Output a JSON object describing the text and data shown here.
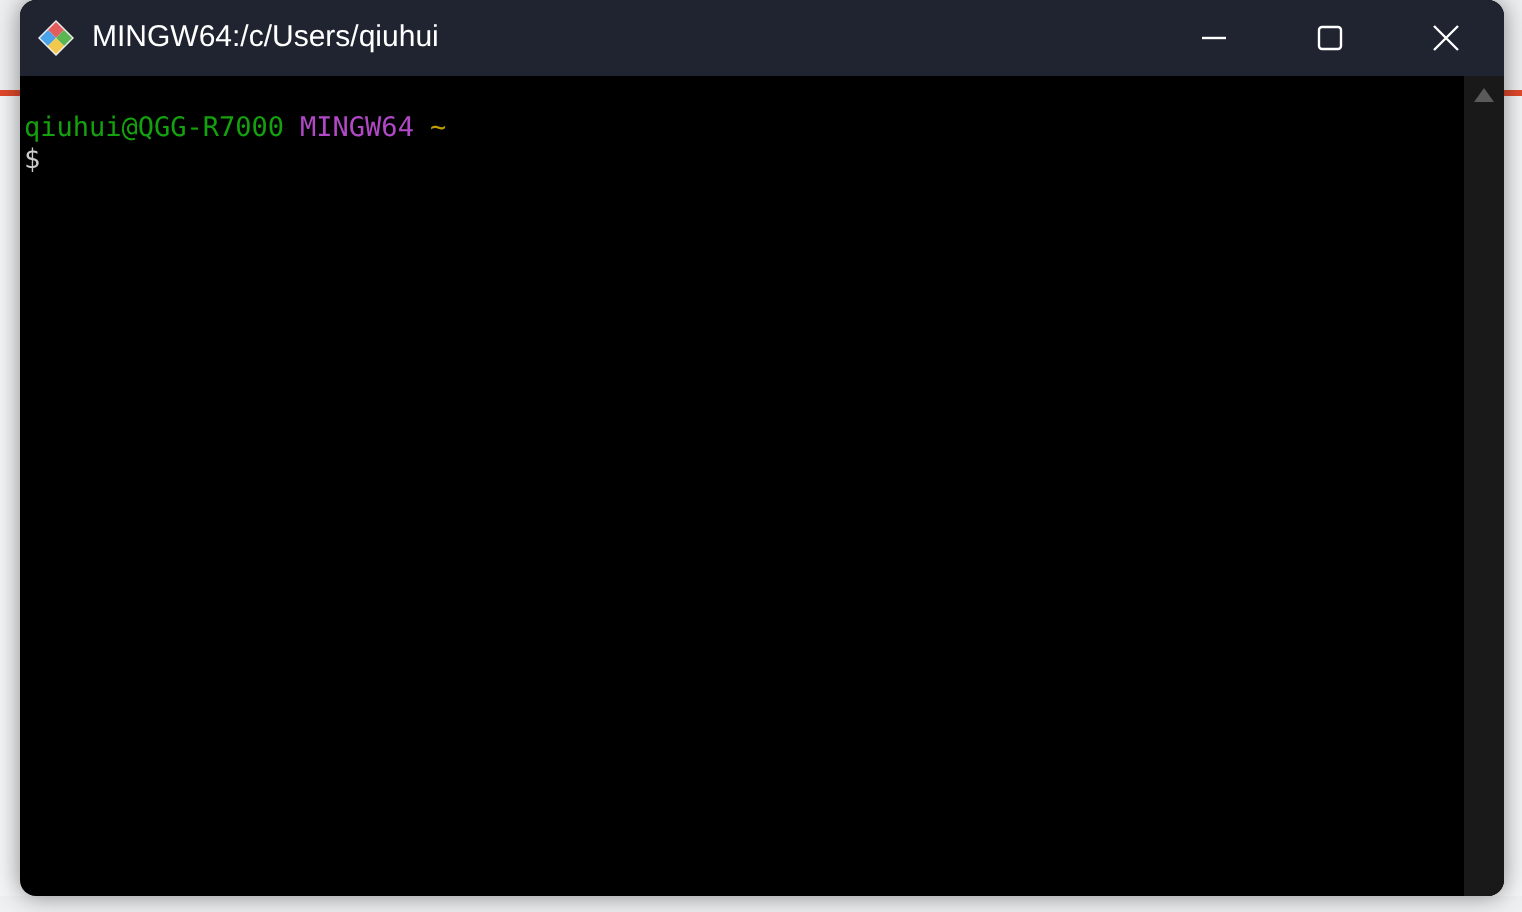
{
  "window": {
    "title": "MINGW64:/c/Users/qiuhui"
  },
  "terminal": {
    "lines": [
      {
        "segments": [
          {
            "text": "qiuhui@QGG-R7000",
            "color": "#13a10e"
          },
          {
            "text": "MINGW64",
            "color": "#b148c6"
          },
          {
            "text": "~",
            "color": "#c19c00"
          }
        ]
      },
      {
        "segments": [
          {
            "text": "$",
            "color": "#cccccc"
          }
        ]
      }
    ]
  }
}
